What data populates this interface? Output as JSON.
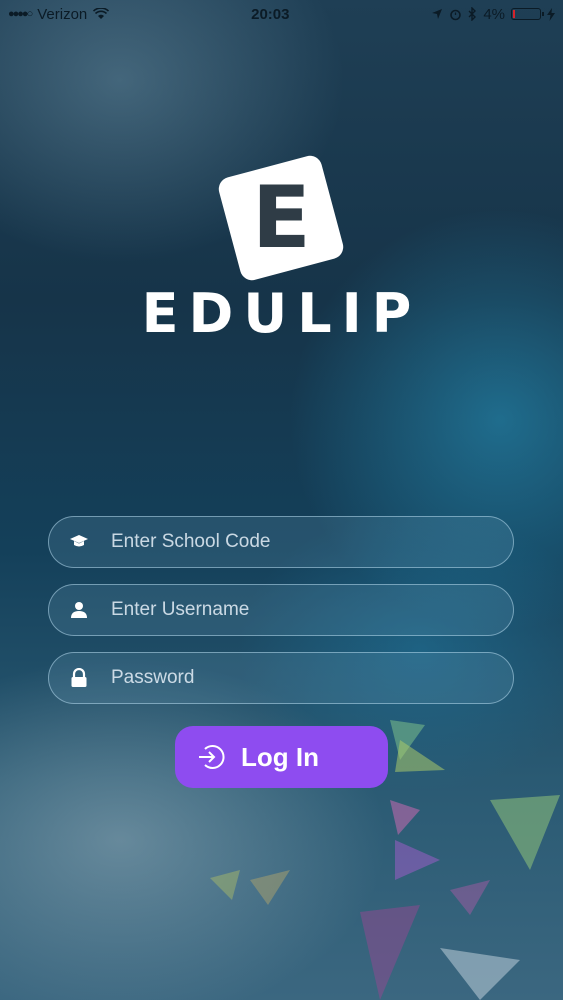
{
  "status_bar": {
    "carrier": "Verizon",
    "time": "20:03",
    "battery": "4%",
    "battery_level": 0.04
  },
  "brand": {
    "logo_letter": "E",
    "name": "EDULIP"
  },
  "form": {
    "school_code_placeholder": "Enter School Code",
    "username_placeholder": "Enter Username",
    "password_placeholder": "Password",
    "login_label": "Log In"
  },
  "colors": {
    "accent": "#8e4cf0",
    "logo_text": "#2f3c46"
  },
  "icons": {
    "school_code": "graduation-cap-icon",
    "username": "user-icon",
    "password": "lock-icon",
    "login": "sign-in-icon"
  }
}
